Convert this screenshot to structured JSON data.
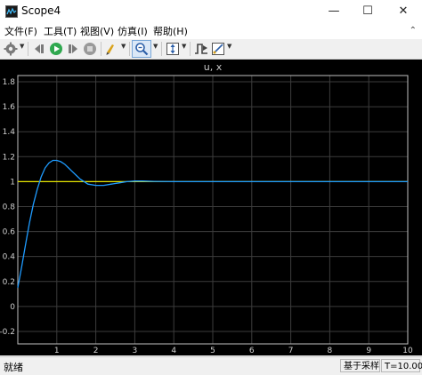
{
  "window": {
    "title": "Scope4",
    "minimize_glyph": "—",
    "maximize_glyph": "☐",
    "close_glyph": "✕"
  },
  "menu": [
    "文件(F)",
    "工具(T)",
    "视图(V)",
    "仿真(I)",
    "帮助(H)"
  ],
  "toolbar": {
    "icons": [
      "settings-icon",
      "step-back-icon",
      "run-icon",
      "step-forward-icon",
      "stop-icon",
      "highlight-icon",
      "zoom-icon",
      "autoscale-icon",
      "triggers-icon",
      "measurements-icon"
    ]
  },
  "chart_data": {
    "type": "line",
    "title": "u, x",
    "xlabel": "",
    "ylabel": "",
    "xlim": [
      0,
      10
    ],
    "ylim": [
      -0.3,
      1.85
    ],
    "xticks": [
      1,
      2,
      3,
      4,
      5,
      6,
      7,
      8,
      9,
      10
    ],
    "yticks": [
      -0.2,
      0,
      0.2,
      0.4,
      0.6,
      0.8,
      1,
      1.2,
      1.4,
      1.6,
      1.8
    ],
    "xtick_labels": [
      "1",
      "2",
      "3",
      "4",
      "5",
      "6",
      "7",
      "8",
      "9",
      "10"
    ],
    "ytick_labels": [
      "-0.2",
      "0",
      "0.2",
      "0.4",
      "0.6",
      "0.8",
      "1",
      "1.2",
      "1.4",
      "1.6",
      "1.8"
    ],
    "grid": true,
    "series": [
      {
        "color": "#e6e600",
        "x": [
          0,
          10
        ],
        "y": [
          1,
          1
        ]
      },
      {
        "color": "#1e9bff",
        "x": [
          0,
          0.1,
          0.2,
          0.3,
          0.4,
          0.5,
          0.6,
          0.7,
          0.8,
          0.9,
          1.0,
          1.1,
          1.2,
          1.3,
          1.4,
          1.5,
          1.6,
          1.8,
          2.0,
          2.2,
          2.4,
          2.6,
          2.8,
          3.0,
          3.2,
          3.5,
          4.0,
          5.0,
          6.0,
          8.0,
          10.0
        ],
        "y": [
          0.15,
          0.32,
          0.5,
          0.67,
          0.82,
          0.94,
          1.04,
          1.11,
          1.15,
          1.17,
          1.17,
          1.16,
          1.14,
          1.11,
          1.08,
          1.05,
          1.02,
          0.98,
          0.97,
          0.97,
          0.98,
          0.99,
          1.0,
          1.005,
          1.005,
          1.002,
          1.0,
          1.0,
          1.0,
          1.0,
          1.0
        ]
      }
    ]
  },
  "status": {
    "text": "就绪",
    "sample_mode": "基于采样",
    "time": "T=10.000"
  }
}
